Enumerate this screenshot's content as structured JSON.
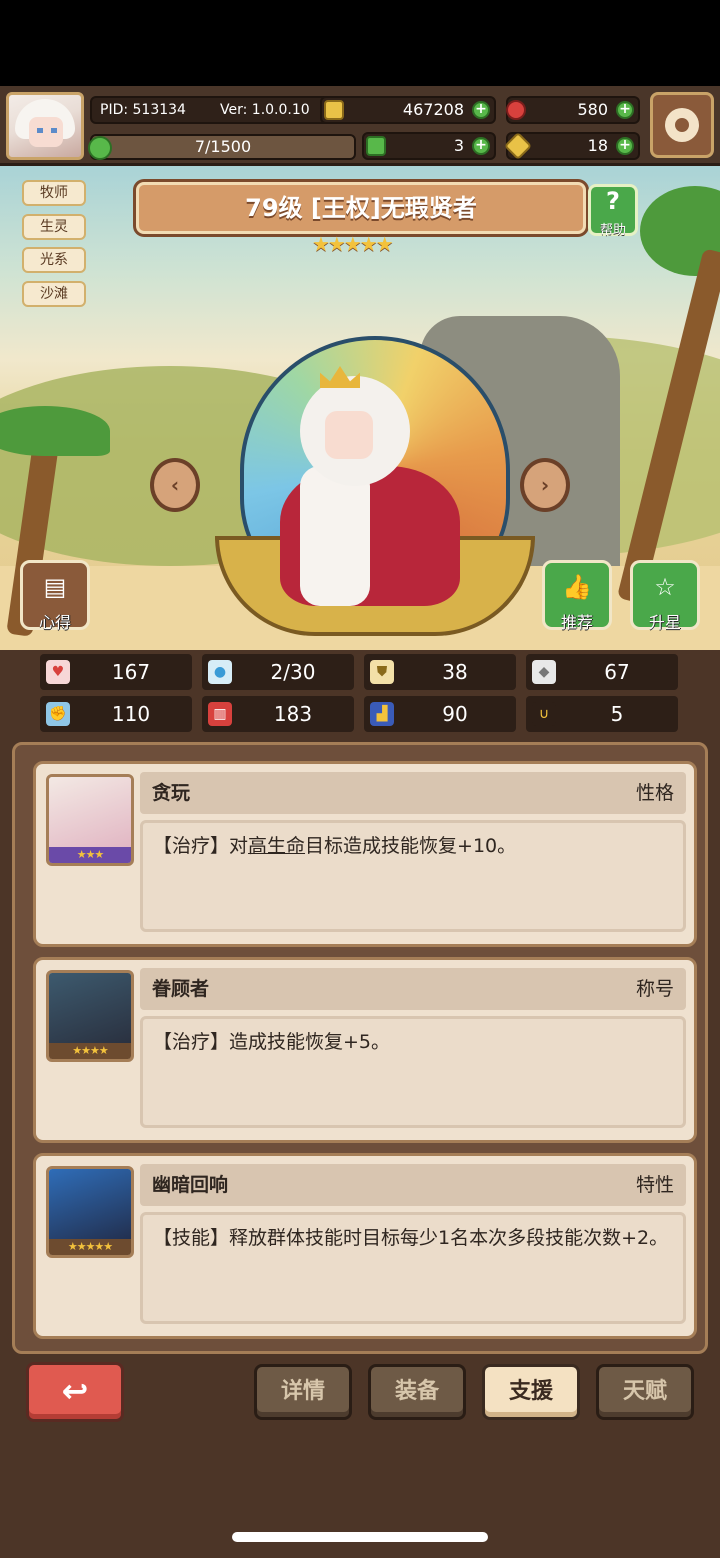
{
  "header": {
    "pid": "PID: 513134",
    "version": "Ver: 1.0.0.10",
    "gold": "467208",
    "gems": "580",
    "stamina": "7/1500",
    "clover": "3",
    "keys": "18"
  },
  "hero": {
    "tags": [
      "牧师",
      "生灵",
      "光系",
      "沙滩"
    ],
    "title": "79级 [王权]无瑕贤者",
    "stars": "★★★★★",
    "help_label": "帮助",
    "left_button_label": "心得",
    "recommend_label": "推荐",
    "upgrade_star_label": "升星"
  },
  "stats": [
    "167",
    "2/30",
    "38",
    "67",
    "110",
    "183",
    "90",
    "5"
  ],
  "cards": [
    {
      "name": "贪玩",
      "kind": "性格",
      "stars": "★★★",
      "desc_pre": "【治疗】对",
      "desc_u": "高生命",
      "desc_post": "目标造成技能恢复+10。"
    },
    {
      "name": "眷顾者",
      "kind": "称号",
      "stars": "★★★★",
      "desc_pre": "【治疗】造成技能恢复+5。",
      "desc_u": "",
      "desc_post": ""
    },
    {
      "name": "幽暗回响",
      "kind": "特性",
      "stars": "★★★★★",
      "desc_pre": "【技能】释放群体技能时目标每少1名本次多段技能次数+2。",
      "desc_u": "",
      "desc_post": ""
    }
  ],
  "tabs": [
    "详情",
    "装备",
    "支援",
    "天赋"
  ],
  "colors": {
    "accent_green": "#58b84a",
    "active_tab": "#f4e1c2",
    "back_button": "#e05a50"
  }
}
